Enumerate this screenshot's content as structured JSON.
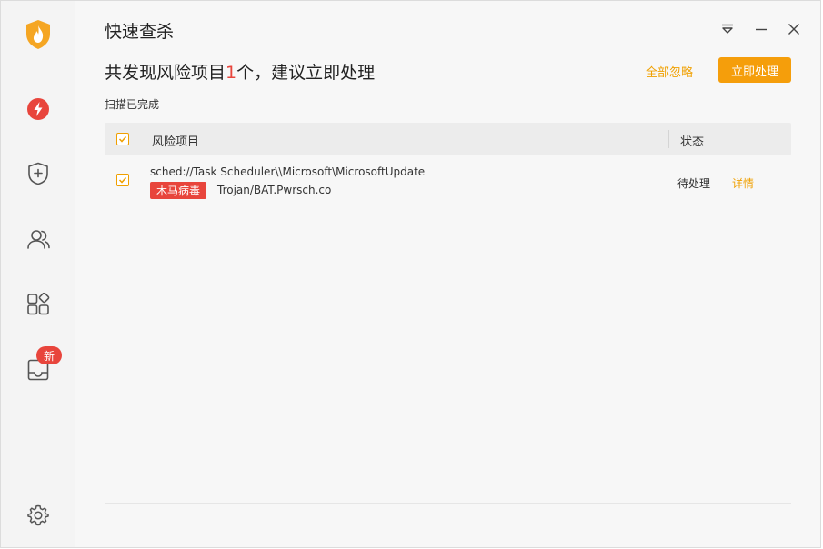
{
  "app": {
    "title": "快速查杀"
  },
  "sidebar": {
    "items": [
      {
        "icon": "shield-flame-icon"
      },
      {
        "icon": "lightning-icon"
      },
      {
        "icon": "shield-plus-icon"
      },
      {
        "icon": "users-icon"
      },
      {
        "icon": "apps-icon"
      },
      {
        "icon": "inbox-icon",
        "badge": "新"
      },
      {
        "icon": "gear-icon"
      }
    ]
  },
  "summary": {
    "prefix": "共发现风险项目",
    "count": "1",
    "suffix": "个，建议立即处理"
  },
  "actions": {
    "ignore_all": "全部忽略",
    "handle_now": "立即处理"
  },
  "scan_status": "扫描已完成",
  "table": {
    "headers": {
      "risk": "风险项目",
      "state": "状态"
    },
    "rows": [
      {
        "path": "sched://Task Scheduler\\\\Microsoft\\MicrosoftUpdate",
        "tag": "木马病毒",
        "virus": "Trojan/BAT.Pwrsch.co",
        "state": "待处理",
        "detail": "详情"
      }
    ]
  },
  "colors": {
    "accent": "#f59e0b",
    "danger": "#e8453c",
    "link": "#f0a000"
  }
}
